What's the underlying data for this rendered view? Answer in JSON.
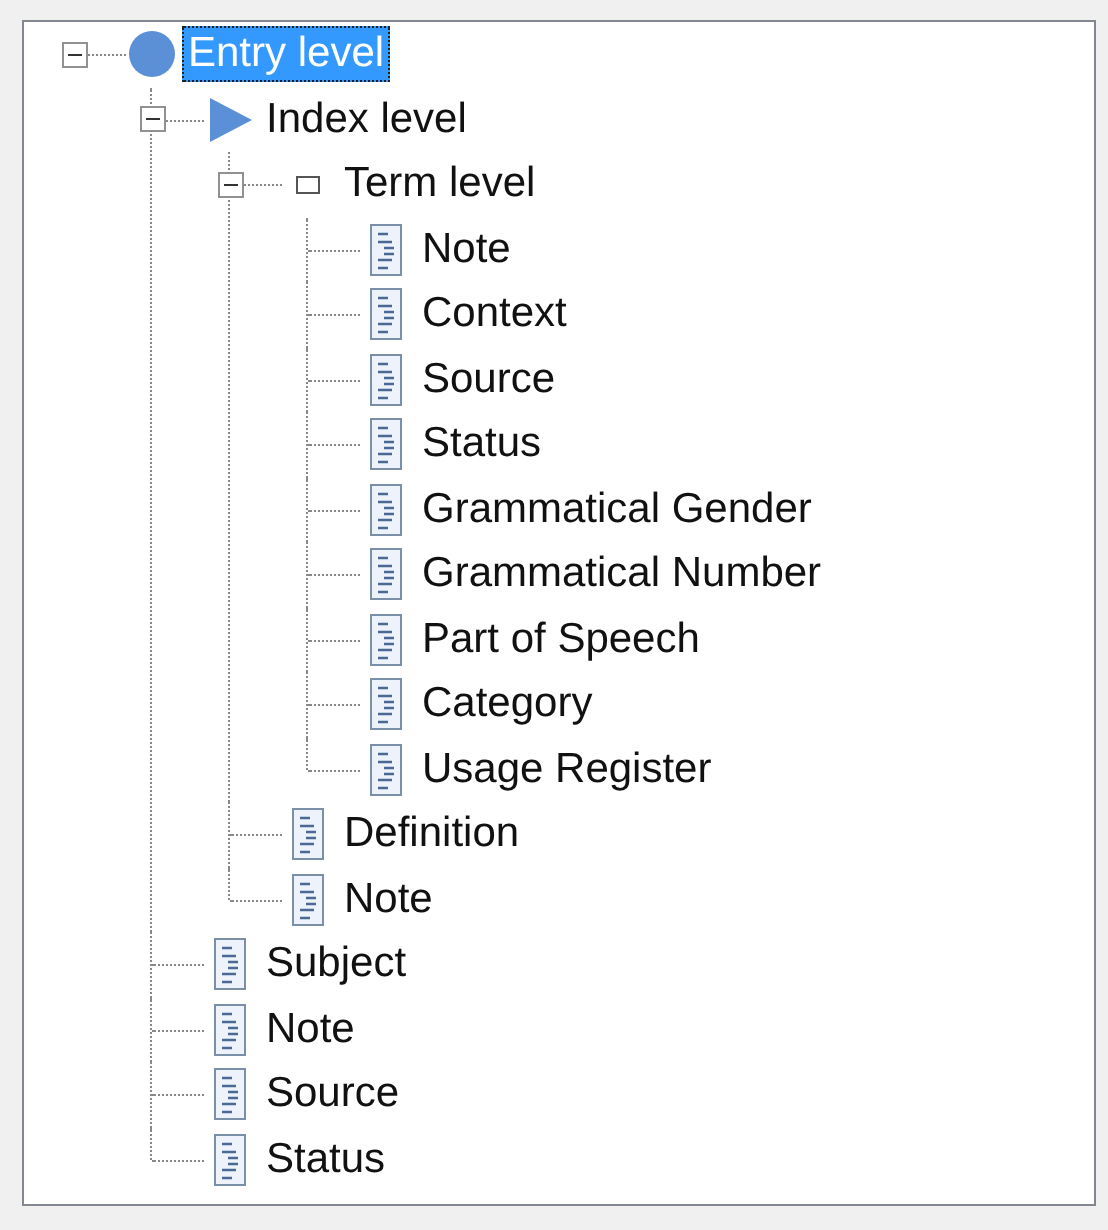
{
  "tree": {
    "nodes": [
      {
        "label": "Entry level",
        "kind": "entry",
        "expanded": true,
        "selected": true,
        "children": [
          {
            "label": "Index level",
            "kind": "index",
            "expanded": true,
            "selected": false,
            "children": [
              {
                "label": "Term level",
                "kind": "term",
                "expanded": true,
                "selected": false,
                "children": [
                  {
                    "label": "Note",
                    "kind": "field",
                    "selected": false
                  },
                  {
                    "label": "Context",
                    "kind": "field",
                    "selected": false
                  },
                  {
                    "label": "Source",
                    "kind": "field",
                    "selected": false
                  },
                  {
                    "label": "Status",
                    "kind": "field",
                    "selected": false
                  },
                  {
                    "label": "Grammatical Gender",
                    "kind": "field",
                    "selected": false
                  },
                  {
                    "label": "Grammatical Number",
                    "kind": "field",
                    "selected": false
                  },
                  {
                    "label": "Part of Speech",
                    "kind": "field",
                    "selected": false
                  },
                  {
                    "label": "Category",
                    "kind": "field",
                    "selected": false
                  },
                  {
                    "label": "Usage Register",
                    "kind": "field",
                    "selected": false
                  }
                ]
              },
              {
                "label": "Definition",
                "kind": "field",
                "selected": false
              },
              {
                "label": "Note",
                "kind": "field",
                "selected": false
              }
            ]
          },
          {
            "label": "Subject",
            "kind": "field",
            "selected": false
          },
          {
            "label": "Note",
            "kind": "field",
            "selected": false
          },
          {
            "label": "Source",
            "kind": "field",
            "selected": false
          },
          {
            "label": "Status",
            "kind": "field",
            "selected": false
          }
        ]
      }
    ]
  }
}
